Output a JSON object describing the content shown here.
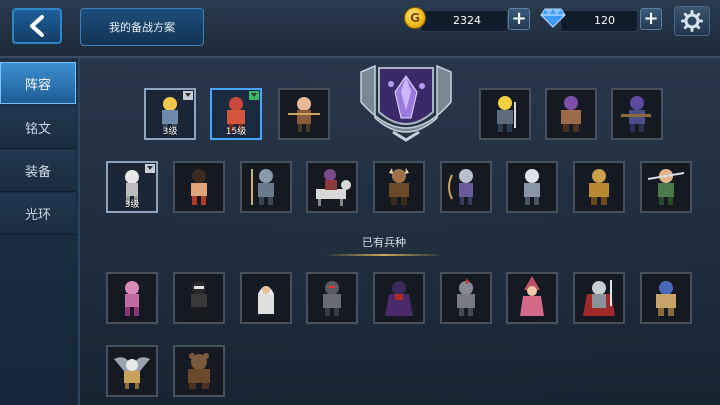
{
  "header": {
    "title_button": "我的备战方案",
    "gold": "2324",
    "gems": "120"
  },
  "sidebar": {
    "tabs": [
      {
        "label": "阵容",
        "active": true
      },
      {
        "label": "铭文",
        "active": false
      },
      {
        "label": "装备",
        "active": false
      },
      {
        "label": "光环",
        "active": false
      }
    ]
  },
  "lineup": [
    {
      "name": "blonde-knight",
      "level": "3级"
    },
    {
      "name": "red-armored-warrior",
      "level": "15级"
    },
    {
      "name": "archer",
      "level": ""
    }
  ],
  "emblem_icon": "crystal-shield-emblem",
  "recommended_row": [
    {
      "name": "yellow-hair-swordsman"
    },
    {
      "name": "purple-hair-brawler"
    },
    {
      "name": "purple-helm-crossbowman"
    }
  ],
  "row2": [
    {
      "name": "skeleton",
      "level": "3级"
    },
    {
      "name": "bare-chest-fighter"
    },
    {
      "name": "spearman"
    },
    {
      "name": "horse-rider"
    },
    {
      "name": "viking-warrior"
    },
    {
      "name": "grey-hair-archer"
    },
    {
      "name": "silver-hair-knight"
    },
    {
      "name": "golden-armor-knight"
    },
    {
      "name": "green-swordsman"
    }
  ],
  "owned_section_title": "已有兵种",
  "owned": [
    {
      "name": "pink-ghoul"
    },
    {
      "name": "ninja"
    },
    {
      "name": "white-hood-priest"
    },
    {
      "name": "red-eye-knight"
    },
    {
      "name": "dark-mage"
    },
    {
      "name": "crested-knight"
    },
    {
      "name": "pink-witch"
    },
    {
      "name": "red-cape-swordsman"
    },
    {
      "name": "blue-hair-beast"
    },
    {
      "name": "griffin"
    },
    {
      "name": "brown-bear"
    }
  ],
  "colors": {
    "accent_blue": "#3d8fd1",
    "slot_border": "#46515d",
    "gold": "#f0b814",
    "gem": "#3f9bff"
  }
}
